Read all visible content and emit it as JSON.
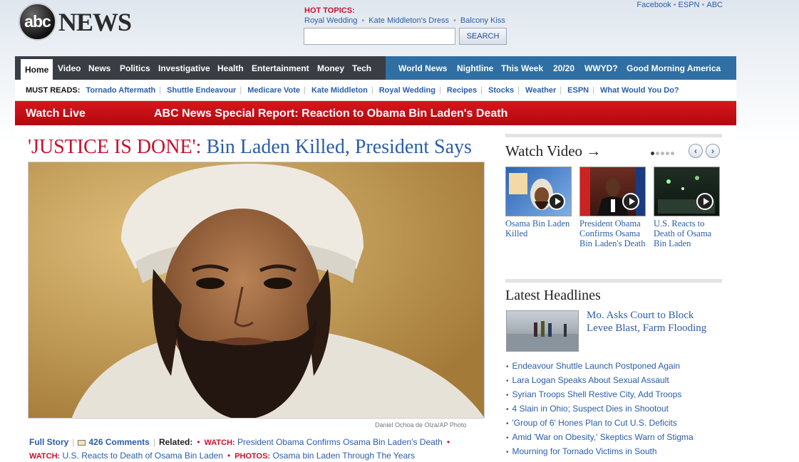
{
  "brand": {
    "logo_circle": "abc",
    "logo_word": "NEWS"
  },
  "top_links": [
    "Facebook",
    "ESPN",
    "ABC"
  ],
  "hot_topics": {
    "title": "HOT TOPICS:",
    "items": [
      "Royal Wedding",
      "Kate Middleton's Dress",
      "Balcony Kiss"
    ]
  },
  "search": {
    "value": "",
    "button": "SEARCH"
  },
  "nav": {
    "left": [
      "Home",
      "Video",
      "News",
      "Politics",
      "Investigative",
      "Health",
      "Entertainment",
      "Money",
      "Tech"
    ],
    "right": [
      "World News",
      "Nightline",
      "This Week",
      "20/20",
      "WWYD?",
      "Good Morning America"
    ]
  },
  "must_reads": {
    "label": "MUST READS:",
    "items": [
      "Tornado Aftermath",
      "Shuttle Endeavour",
      "Medicare Vote",
      "Kate Middleton",
      "Royal Wedding",
      "Recipes",
      "Stocks",
      "Weather",
      "ESPN",
      "What Would You Do?"
    ]
  },
  "live_bar": {
    "watch_live": "Watch Live",
    "report": "ABC News Special Report: Reaction to Obama Bin Laden's Death"
  },
  "main": {
    "headline_red": "'JUSTICE IS DONE':",
    "headline_blue": "Bin Laden Killed, President Says",
    "photo_credit": "Daniel Ochoa de Olza/AP Photo",
    "full_story": "Full Story",
    "comments": "426 Comments",
    "related_label": "Related:",
    "related": [
      {
        "tag": "WATCH:",
        "text": "President Obama Confirms Osama Bin Laden's Death"
      },
      {
        "tag": "WATCH:",
        "text": "U.S. Reacts to Death of Osama Bin Laden"
      },
      {
        "tag": "PHOTOS:",
        "text": "Osama bin Laden Through The Years"
      }
    ]
  },
  "video": {
    "title": "Watch Video →",
    "prev_icon": "‹",
    "next_icon": "›",
    "dots_total": 5,
    "dots_active": 1,
    "items": [
      {
        "caption": "Osama Bin Laden Killed"
      },
      {
        "caption": "President Obama Confirms Osama Bin Laden's Death"
      },
      {
        "caption": "U.S. Reacts to Death of Osama Bin Laden"
      }
    ]
  },
  "latest": {
    "title": "Latest Headlines",
    "featured": "Mo. Asks Court to Block Levee Blast, Farm Flooding",
    "items": [
      "Endeavour Shuttle Launch Postponed Again",
      "Lara Logan Speaks About Sexual Assault",
      "Syrian Troops Shell Restive City, Add Troops",
      "4 Slain in Ohio; Suspect Dies in Shootout",
      "'Group of 6' Hones Plan to Cut U.S. Deficits",
      "Amid 'War on Obesity,' Skeptics Warn of Stigma",
      "Mourning for Tornado Victims in South"
    ]
  },
  "colors": {
    "accent_red": "#c8102e",
    "link_blue": "#2a5da8",
    "nav_dark": "#3a3d43",
    "nav_blue": "#2f6fa3"
  }
}
